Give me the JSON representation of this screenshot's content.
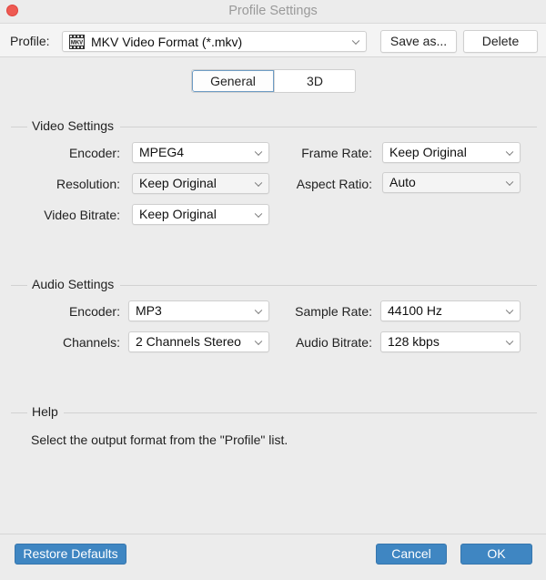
{
  "window": {
    "title": "Profile Settings"
  },
  "profile": {
    "label": "Profile:",
    "selected": "MKV Video Format (*.mkv)",
    "icon": "mkv-film-icon",
    "icon_text": "MKV",
    "save_as_label": "Save as...",
    "delete_label": "Delete"
  },
  "tabs": [
    {
      "label": "General",
      "active": true
    },
    {
      "label": "3D",
      "active": false
    }
  ],
  "video": {
    "title": "Video Settings",
    "encoder": {
      "label": "Encoder:",
      "value": "MPEG4"
    },
    "frame_rate": {
      "label": "Frame Rate:",
      "value": "Keep Original"
    },
    "resolution": {
      "label": "Resolution:",
      "value": "Keep Original"
    },
    "aspect_ratio": {
      "label": "Aspect Ratio:",
      "value": "Auto"
    },
    "bitrate": {
      "label": "Video Bitrate:",
      "value": "Keep Original"
    }
  },
  "audio": {
    "title": "Audio Settings",
    "encoder": {
      "label": "Encoder:",
      "value": "MP3"
    },
    "sample_rate": {
      "label": "Sample Rate:",
      "value": "44100 Hz"
    },
    "channels": {
      "label": "Channels:",
      "value": "2 Channels Stereo"
    },
    "bitrate": {
      "label": "Audio Bitrate:",
      "value": "128 kbps"
    }
  },
  "help": {
    "title": "Help",
    "text": "Select the output format from the \"Profile\" list."
  },
  "footer": {
    "restore_label": "Restore Defaults",
    "cancel_label": "Cancel",
    "ok_label": "OK"
  },
  "colors": {
    "accent_button": "#3f86c2",
    "close_button": "#ee5a52",
    "window_bg": "#ececec"
  }
}
